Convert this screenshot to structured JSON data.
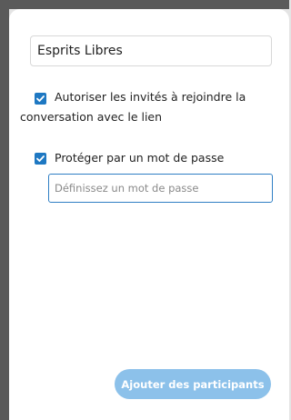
{
  "conversation": {
    "name_value": "Esprits Libres"
  },
  "options": {
    "guests_label": "Autoriser les invités à rejoindre la conversation avec le lien",
    "guests_checked": true,
    "password_label": "Protéger par un mot de passe",
    "password_checked": true,
    "password_placeholder": "Définissez un mot de passe"
  },
  "actions": {
    "add_participants_label": "Ajouter des participants"
  },
  "colors": {
    "accent": "#1e78c2",
    "button_disabled": "#8cc1ea",
    "backdrop": "#5a5a5a"
  },
  "icons": {
    "checkbox_checked": "checkmark-icon"
  }
}
